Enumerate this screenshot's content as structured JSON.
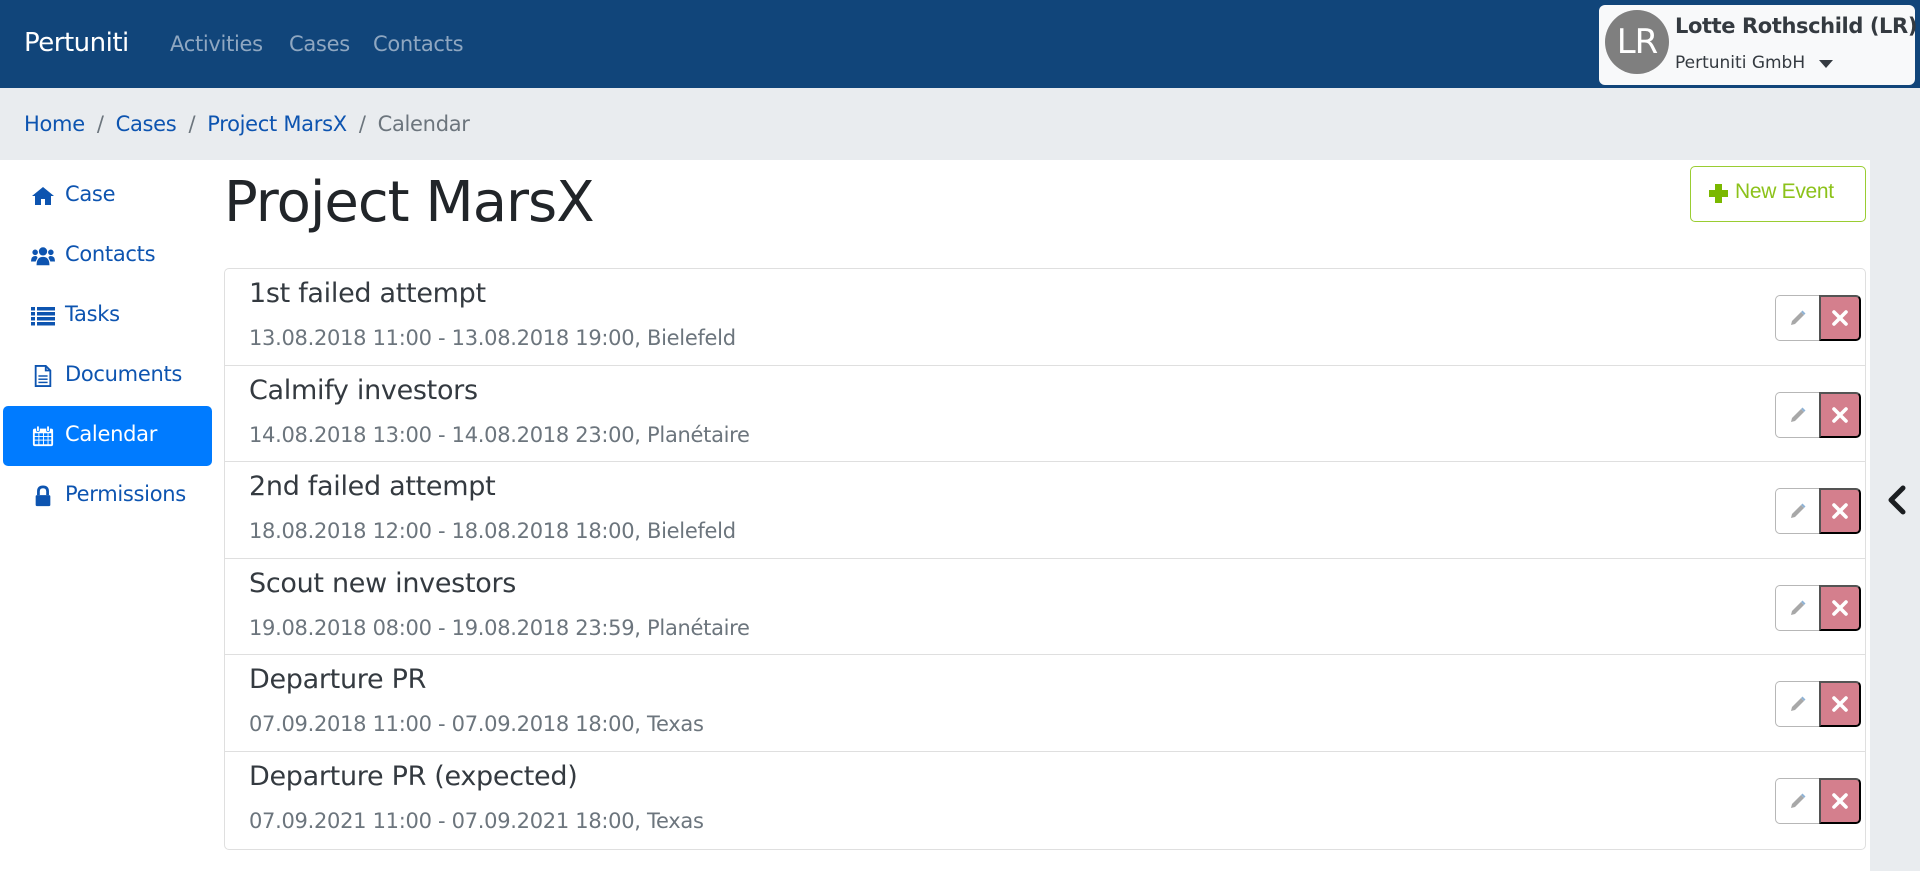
{
  "navbar": {
    "brand": "Pertuniti",
    "links": [
      "Activities",
      "Cases",
      "Contacts"
    ],
    "user": {
      "initials": "LR",
      "name": "Lotte Rothschild (LR)",
      "organization": "Pertuniti GmbH"
    }
  },
  "breadcrumb": {
    "items": [
      "Home",
      "Cases",
      "Project MarsX"
    ],
    "current": "Calendar",
    "separator": "/"
  },
  "sidebar": {
    "items": [
      {
        "label": "Case",
        "icon": "home-icon",
        "active": false
      },
      {
        "label": "Contacts",
        "icon": "users-icon",
        "active": false
      },
      {
        "label": "Tasks",
        "icon": "list-icon",
        "active": false
      },
      {
        "label": "Documents",
        "icon": "file-icon",
        "active": false
      },
      {
        "label": "Calendar",
        "icon": "calendar-icon",
        "active": true
      },
      {
        "label": "Permissions",
        "icon": "lock-icon",
        "active": false
      }
    ]
  },
  "main": {
    "title": "Project MarsX",
    "new_event_label": "New Event",
    "events": [
      {
        "title": "1st failed attempt",
        "details": "13.08.2018 11:00 - 13.08.2018 19:00, Bielefeld"
      },
      {
        "title": "Calmify investors",
        "details": "14.08.2018 13:00 - 14.08.2018 23:00, Planétaire"
      },
      {
        "title": "2nd failed attempt",
        "details": "18.08.2018 12:00 - 18.08.2018 18:00, Bielefeld"
      },
      {
        "title": "Scout new investors",
        "details": "19.08.2018 08:00 - 19.08.2018 23:59, Planétaire"
      },
      {
        "title": "Departure PR",
        "details": "07.09.2018 11:00 - 07.09.2018 18:00, Texas"
      },
      {
        "title": "Departure PR (expected)",
        "details": "07.09.2021 11:00 - 07.09.2021 18:00, Texas"
      }
    ]
  },
  "colors": {
    "navbar": "#11457a",
    "link": "#0d54b0",
    "active": "#007bff",
    "success": "#8cc21a",
    "danger": "#d47f8d"
  }
}
